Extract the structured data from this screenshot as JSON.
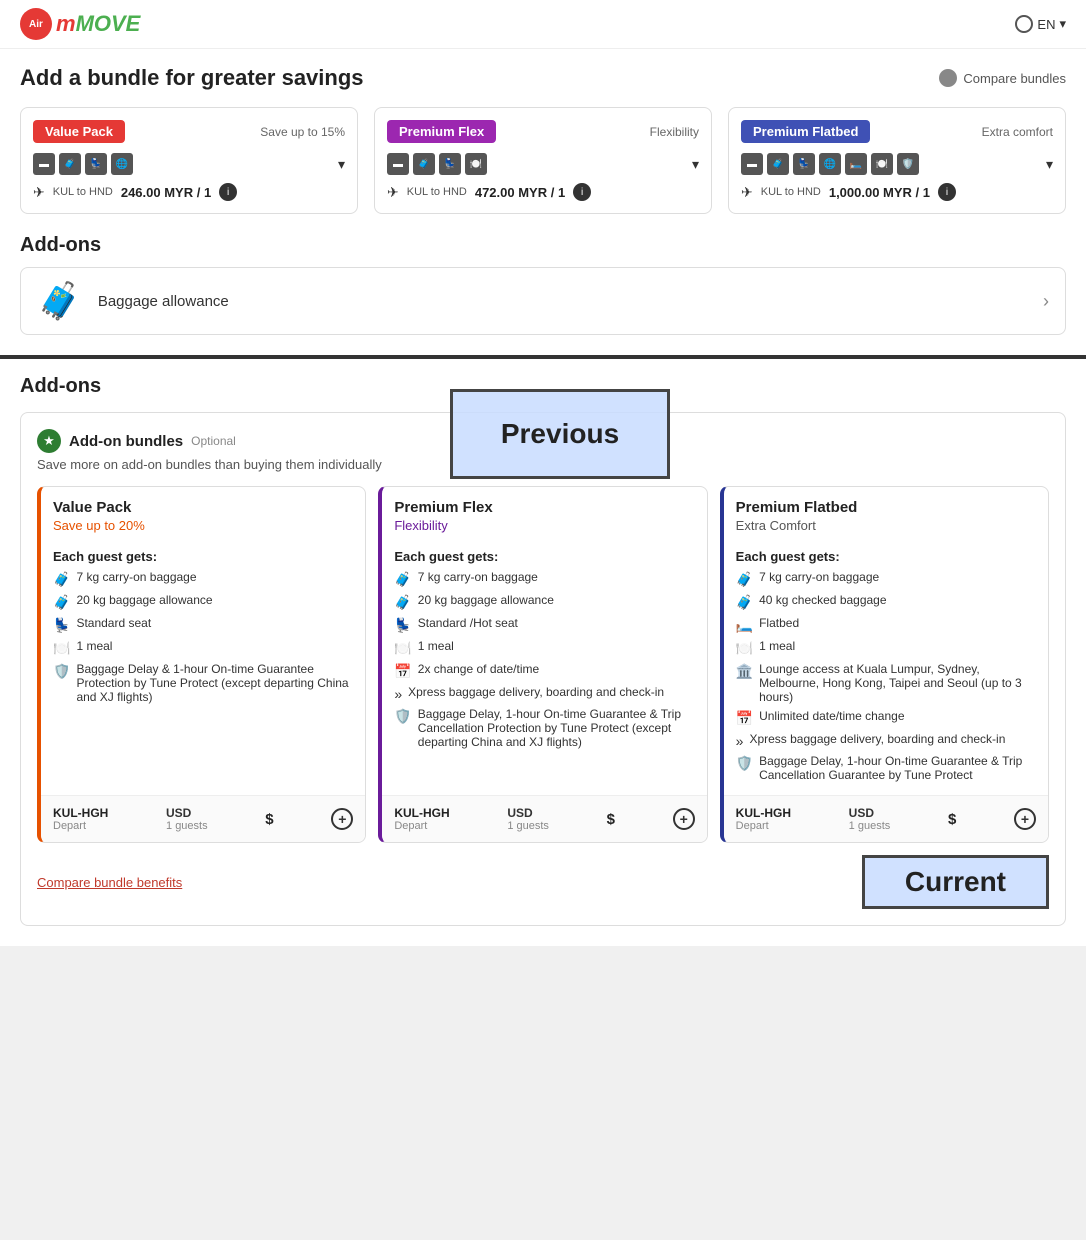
{
  "nav": {
    "logo_text": "MOVE",
    "lang": "EN"
  },
  "top": {
    "title": "Add a bundle for greater savings",
    "compare_label": "Compare bundles",
    "bundles": [
      {
        "tag": "Value Pack",
        "tag_class": "tag-red",
        "subtitle": "Save up to 15%",
        "price": "246.00 MYR / 1",
        "route": "KUL to HND"
      },
      {
        "tag": "Premium Flex",
        "tag_class": "tag-purple",
        "subtitle": "Flexibility",
        "price": "472.00 MYR / 1",
        "route": "KUL to HND"
      },
      {
        "tag": "Premium Flatbed",
        "tag_class": "tag-blue",
        "subtitle": "Extra comfort",
        "price": "1,000.00 MYR / 1",
        "route": "KUL to HND"
      }
    ],
    "addons_title": "Add-ons",
    "baggage_label": "Baggage allowance",
    "previous_label": "Previous"
  },
  "bottom": {
    "section_title": "Add-ons",
    "addon_bundles_title": "Add-on bundles",
    "optional_text": "Optional",
    "save_text": "Save more on add-on bundles than buying them individually",
    "bundles": [
      {
        "name": "Value Pack",
        "subtitle": "Save up to 20%",
        "subtitle_class": "sub-orange",
        "border_class": "value",
        "each_guest": "Each guest gets:",
        "features": [
          {
            "icon": "🧳",
            "text": "7 kg carry-on baggage"
          },
          {
            "icon": "🧳",
            "text": "20 kg baggage allowance"
          },
          {
            "icon": "💺",
            "text": "Standard seat"
          },
          {
            "icon": "🍽️",
            "text": "1 meal"
          },
          {
            "icon": "🛡️",
            "text": "Baggage Delay & 1-hour On-time Guarantee Protection by Tune Protect (except departing China and XJ flights)"
          }
        ],
        "route": "KUL-HGH",
        "depart": "Depart",
        "currency": "USD",
        "dollar": "$",
        "guests": "1 guests"
      },
      {
        "name": "Premium Flex",
        "subtitle": "Flexibility",
        "subtitle_class": "sub-purple",
        "border_class": "premium-flex",
        "each_guest": "Each guest gets:",
        "features": [
          {
            "icon": "🧳",
            "text": "7 kg carry-on baggage"
          },
          {
            "icon": "🧳",
            "text": "20 kg baggage allowance"
          },
          {
            "icon": "💺",
            "text": "Standard /Hot seat"
          },
          {
            "icon": "🍽️",
            "text": "1 meal"
          },
          {
            "icon": "📅",
            "text": "2x change of date/time"
          },
          {
            "icon": "»",
            "text": "Xpress baggage delivery, boarding and check-in"
          },
          {
            "icon": "🛡️",
            "text": "Baggage Delay, 1-hour On-time Guarantee & Trip Cancellation Protection by Tune Protect (except departing China and XJ flights)"
          }
        ],
        "route": "KUL-HGH",
        "depart": "Depart",
        "currency": "USD",
        "dollar": "$",
        "guests": "1 guests"
      },
      {
        "name": "Premium Flatbed",
        "subtitle": "Extra Comfort",
        "subtitle_class": "sub-gray",
        "border_class": "premium-flatbed",
        "each_guest": "Each guest gets:",
        "features": [
          {
            "icon": "🧳",
            "text": "7 kg carry-on baggage"
          },
          {
            "icon": "🧳",
            "text": "40 kg checked baggage"
          },
          {
            "icon": "🛏️",
            "text": "Flatbed"
          },
          {
            "icon": "🍽️",
            "text": "1 meal"
          },
          {
            "icon": "🏛️",
            "text": "Lounge access at Kuala Lumpur, Sydney, Melbourne, Hong Kong, Taipei and Seoul (up to 3 hours)"
          },
          {
            "icon": "📅",
            "text": "Unlimited date/time change"
          },
          {
            "icon": "»",
            "text": "Xpress baggage delivery, boarding and check-in"
          },
          {
            "icon": "🛡️",
            "text": "Baggage Delay, 1-hour On-time Guarantee & Trip Cancellation Guarantee by Tune Protect"
          }
        ],
        "route": "KUL-HGH",
        "depart": "Depart",
        "currency": "USD",
        "dollar": "$",
        "guests": "1 guests"
      }
    ],
    "compare_link": "Compare bundle benefits",
    "current_label": "Current"
  }
}
